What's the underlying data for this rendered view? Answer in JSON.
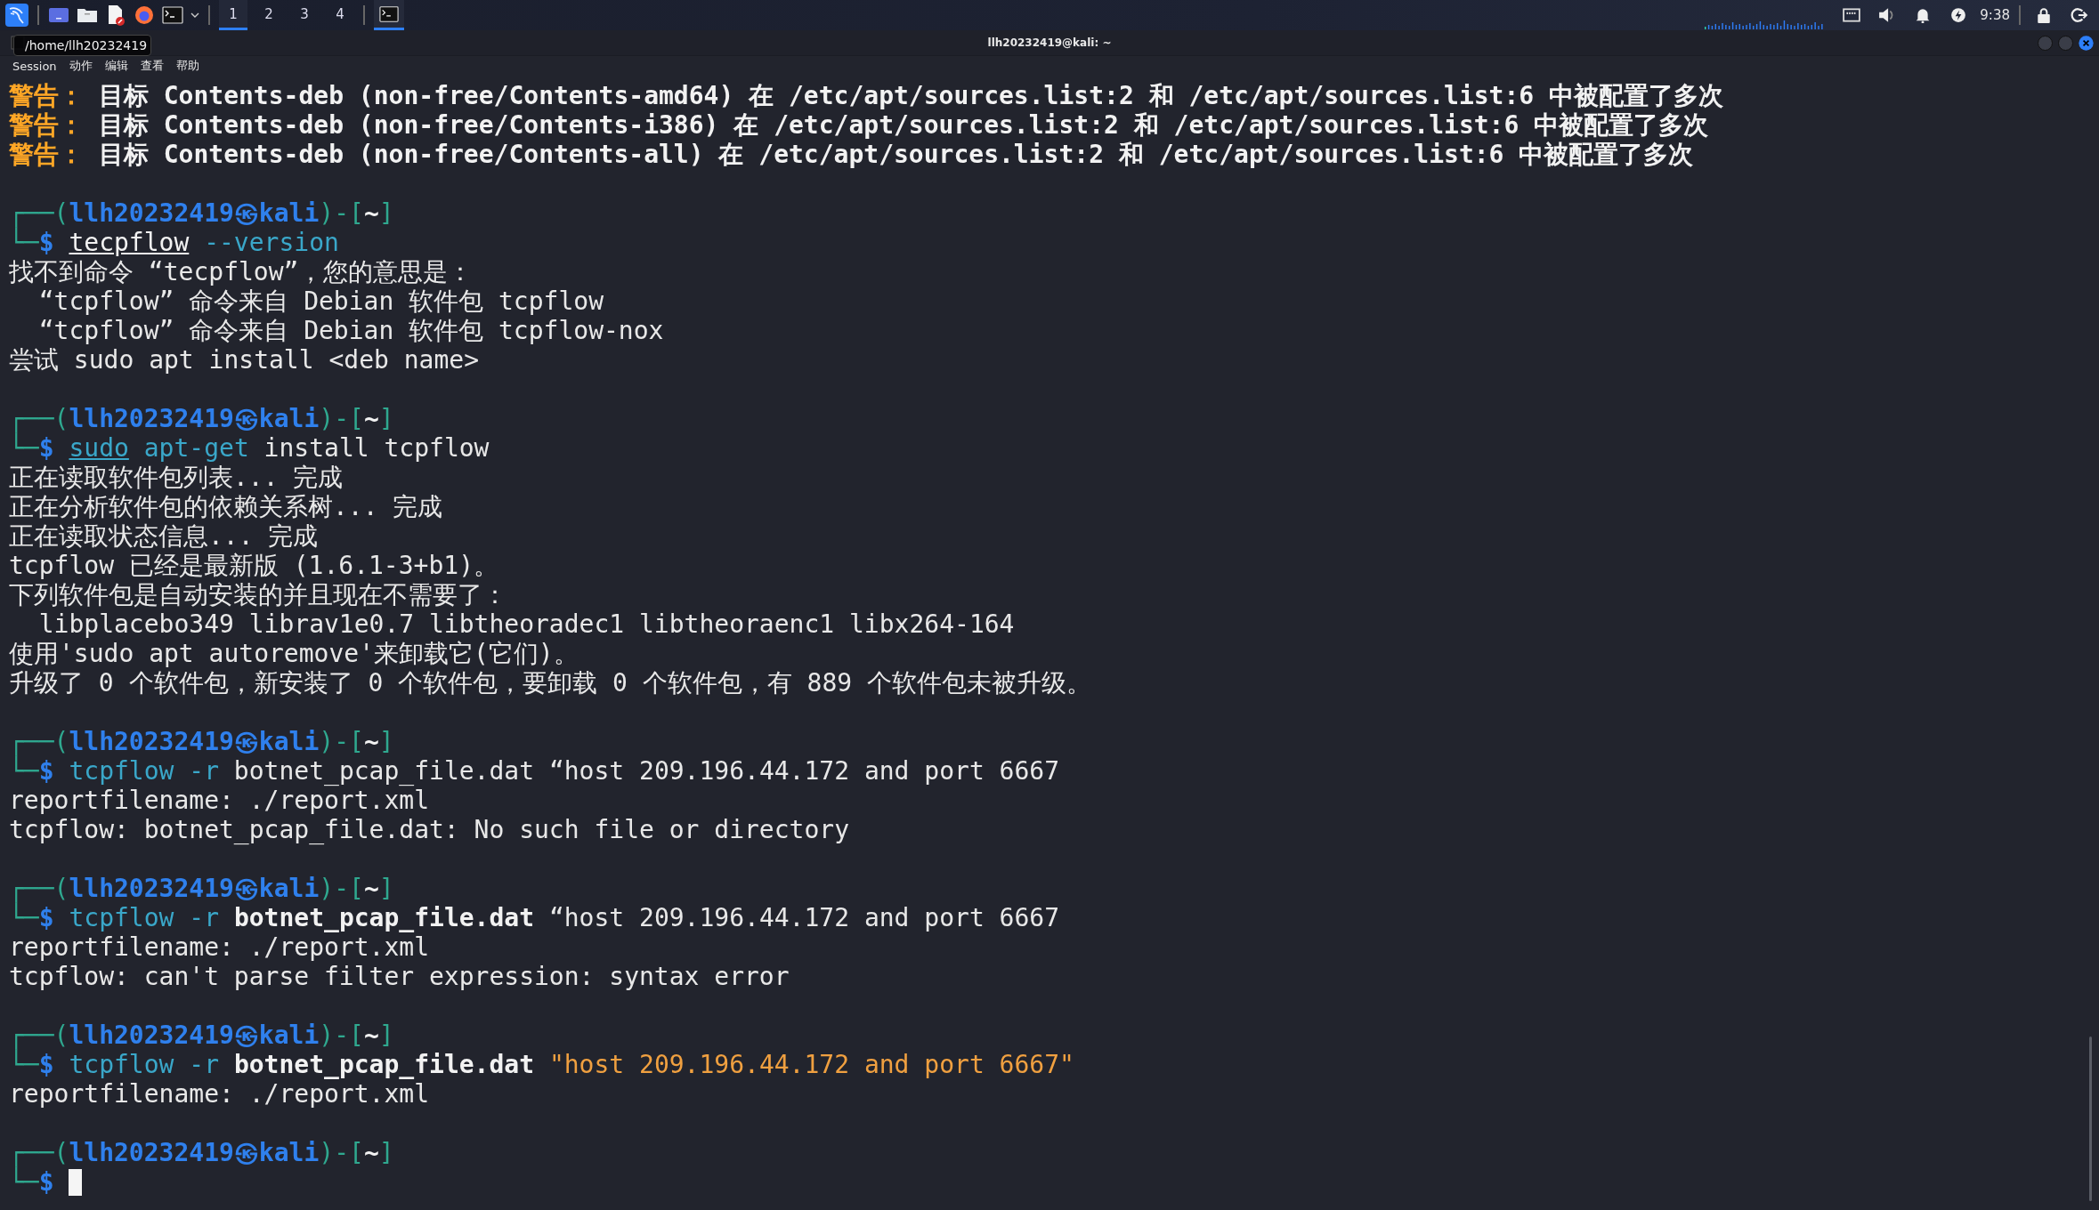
{
  "panel": {
    "workspaces": [
      {
        "label": "1",
        "selected": true
      },
      {
        "label": "2",
        "selected": false
      },
      {
        "label": "3",
        "selected": false
      },
      {
        "label": "4",
        "selected": false
      }
    ],
    "task": {
      "selected": true
    },
    "clock": "9:38"
  },
  "window": {
    "title": "llh20232419@kali: ~",
    "menu": [
      {
        "label": "Session"
      },
      {
        "label": "动作"
      },
      {
        "label": "编辑"
      },
      {
        "label": "查看"
      },
      {
        "label": "帮助"
      }
    ],
    "tooltip": "/home/llh20232419"
  },
  "terminal": {
    "lines": [
      {
        "kind": "text",
        "segments": [
          {
            "text": "警告：",
            "kind": "warn"
          },
          {
            "text": " 目标 Contents-deb (non-free/Contents-amd64) 在 /etc/apt/sources.list:2 和 /etc/apt/sources.list:6 中被配置了多次",
            "kind": "bold"
          }
        ]
      },
      {
        "kind": "text",
        "segments": [
          {
            "text": "警告：",
            "kind": "warn"
          },
          {
            "text": " 目标 Contents-deb (non-free/Contents-i386) 在 /etc/apt/sources.list:2 和 /etc/apt/sources.list:6 中被配置了多次",
            "kind": "bold"
          }
        ]
      },
      {
        "kind": "text",
        "segments": [
          {
            "text": "警告：",
            "kind": "warn"
          },
          {
            "text": " 目标 Contents-deb (non-free/Contents-all) 在 /etc/apt/sources.list:2 和 /etc/apt/sources.list:6 中被配置了多次",
            "kind": "bold"
          }
        ]
      },
      {
        "kind": "blank"
      },
      {
        "kind": "text",
        "segments": [
          {
            "text": "┌──(",
            "kind": "frame"
          },
          {
            "text": "llh20232419㉿kali",
            "kind": "user"
          },
          {
            "text": ")-[",
            "kind": "frame"
          },
          {
            "text": "~",
            "kind": "dir"
          },
          {
            "text": "]",
            "kind": "frame"
          }
        ]
      },
      {
        "kind": "text",
        "segments": [
          {
            "text": "└─",
            "kind": "frame"
          },
          {
            "text": "$ ",
            "kind": "user"
          },
          {
            "text": "tecpflow",
            "kind": "unknown"
          },
          {
            "text": " --version",
            "kind": "cmd"
          }
        ]
      },
      {
        "kind": "text",
        "segments": [
          {
            "text": "找不到命令 “tecpflow”，您的意思是：",
            "kind": "plain"
          }
        ]
      },
      {
        "kind": "text",
        "segments": [
          {
            "text": "  “tcpflow” 命令来自 Debian 软件包 tcpflow",
            "kind": "plain"
          }
        ]
      },
      {
        "kind": "text",
        "segments": [
          {
            "text": "  “tcpflow” 命令来自 Debian 软件包 tcpflow-nox",
            "kind": "plain"
          }
        ]
      },
      {
        "kind": "text",
        "segments": [
          {
            "text": "尝试 sudo apt install <deb name>",
            "kind": "plain"
          }
        ]
      },
      {
        "kind": "blank"
      },
      {
        "kind": "text",
        "segments": [
          {
            "text": "┌──(",
            "kind": "frame"
          },
          {
            "text": "llh20232419㉿kali",
            "kind": "user"
          },
          {
            "text": ")-[",
            "kind": "frame"
          },
          {
            "text": "~",
            "kind": "dir"
          },
          {
            "text": "]",
            "kind": "frame"
          }
        ]
      },
      {
        "kind": "text",
        "segments": [
          {
            "text": "└─",
            "kind": "frame"
          },
          {
            "text": "$ ",
            "kind": "user"
          },
          {
            "text": "sudo",
            "kind": "sudo"
          },
          {
            "text": " apt-get",
            "kind": "cmd"
          },
          {
            "text": " install tcpflow",
            "kind": "plain"
          }
        ]
      },
      {
        "kind": "text",
        "segments": [
          {
            "text": "正在读取软件包列表... 完成",
            "kind": "plain"
          }
        ]
      },
      {
        "kind": "text",
        "segments": [
          {
            "text": "正在分析软件包的依赖关系树... 完成",
            "kind": "plain"
          }
        ]
      },
      {
        "kind": "text",
        "segments": [
          {
            "text": "正在读取状态信息... 完成",
            "kind": "plain"
          }
        ]
      },
      {
        "kind": "text",
        "segments": [
          {
            "text": "tcpflow 已经是最新版 (1.6.1-3+b1)。",
            "kind": "plain"
          }
        ]
      },
      {
        "kind": "text",
        "segments": [
          {
            "text": "下列软件包是自动安装的并且现在不需要了：",
            "kind": "plain"
          }
        ]
      },
      {
        "kind": "text",
        "segments": [
          {
            "text": "  libplacebo349 librav1e0.7 libtheoradec1 libtheoraenc1 libx264-164",
            "kind": "plain"
          }
        ]
      },
      {
        "kind": "text",
        "segments": [
          {
            "text": "使用'sudo apt autoremove'来卸载它(它们)。",
            "kind": "plain"
          }
        ]
      },
      {
        "kind": "text",
        "segments": [
          {
            "text": "升级了 0 个软件包，新安装了 0 个软件包，要卸载 0 个软件包，有 889 个软件包未被升级。",
            "kind": "plain"
          }
        ]
      },
      {
        "kind": "blank"
      },
      {
        "kind": "text",
        "segments": [
          {
            "text": "┌──(",
            "kind": "frame"
          },
          {
            "text": "llh20232419㉿kali",
            "kind": "user"
          },
          {
            "text": ")-[",
            "kind": "frame"
          },
          {
            "text": "~",
            "kind": "dir"
          },
          {
            "text": "]",
            "kind": "frame"
          }
        ]
      },
      {
        "kind": "text",
        "segments": [
          {
            "text": "└─",
            "kind": "frame"
          },
          {
            "text": "$ ",
            "kind": "user"
          },
          {
            "text": "tcpflow -r",
            "kind": "cmd"
          },
          {
            "text": " botnet_pcap_file.dat “host 209.196.44.172 and port 6667",
            "kind": "plain"
          }
        ]
      },
      {
        "kind": "text",
        "segments": [
          {
            "text": "reportfilename: ./report.xml",
            "kind": "plain"
          }
        ]
      },
      {
        "kind": "text",
        "segments": [
          {
            "text": "tcpflow: botnet_pcap_file.dat: No such file or directory",
            "kind": "plain"
          }
        ]
      },
      {
        "kind": "blank"
      },
      {
        "kind": "text",
        "segments": [
          {
            "text": "┌──(",
            "kind": "frame"
          },
          {
            "text": "llh20232419㉿kali",
            "kind": "user"
          },
          {
            "text": ")-[",
            "kind": "frame"
          },
          {
            "text": "~",
            "kind": "dir"
          },
          {
            "text": "]",
            "kind": "frame"
          }
        ]
      },
      {
        "kind": "text",
        "segments": [
          {
            "text": "└─",
            "kind": "frame"
          },
          {
            "text": "$ ",
            "kind": "user"
          },
          {
            "text": "tcpflow -r ",
            "kind": "cmd"
          },
          {
            "text": "botnet_pcap_file.dat",
            "kind": "bold"
          },
          {
            "text": " “host 209.196.44.172 and port 6667",
            "kind": "plain"
          }
        ]
      },
      {
        "kind": "text",
        "segments": [
          {
            "text": "reportfilename: ./report.xml",
            "kind": "plain"
          }
        ]
      },
      {
        "kind": "text",
        "segments": [
          {
            "text": "tcpflow: can't parse filter expression: syntax error",
            "kind": "plain"
          }
        ]
      },
      {
        "kind": "blank"
      },
      {
        "kind": "text",
        "segments": [
          {
            "text": "┌──(",
            "kind": "frame"
          },
          {
            "text": "llh20232419㉿kali",
            "kind": "user"
          },
          {
            "text": ")-[",
            "kind": "frame"
          },
          {
            "text": "~",
            "kind": "dir"
          },
          {
            "text": "]",
            "kind": "frame"
          }
        ]
      },
      {
        "kind": "text",
        "segments": [
          {
            "text": "└─",
            "kind": "frame"
          },
          {
            "text": "$ ",
            "kind": "user"
          },
          {
            "text": "tcpflow -r ",
            "kind": "cmd"
          },
          {
            "text": "botnet_pcap_file.dat",
            "kind": "bold"
          },
          {
            "text": " \"host 209.196.44.172 and port 6667\"",
            "kind": "string"
          }
        ]
      },
      {
        "kind": "text",
        "segments": [
          {
            "text": "reportfilename: ./report.xml",
            "kind": "plain"
          }
        ]
      },
      {
        "kind": "blank"
      },
      {
        "kind": "text",
        "segments": [
          {
            "text": "┌──(",
            "kind": "frame"
          },
          {
            "text": "llh20232419㉿kali",
            "kind": "user"
          },
          {
            "text": ")-[",
            "kind": "frame"
          },
          {
            "text": "~",
            "kind": "dir"
          },
          {
            "text": "]",
            "kind": "frame"
          }
        ]
      },
      {
        "kind": "text",
        "segments": [
          {
            "text": "└─",
            "kind": "frame"
          },
          {
            "text": "$ ",
            "kind": "user"
          }
        ],
        "cursor": true
      }
    ]
  }
}
